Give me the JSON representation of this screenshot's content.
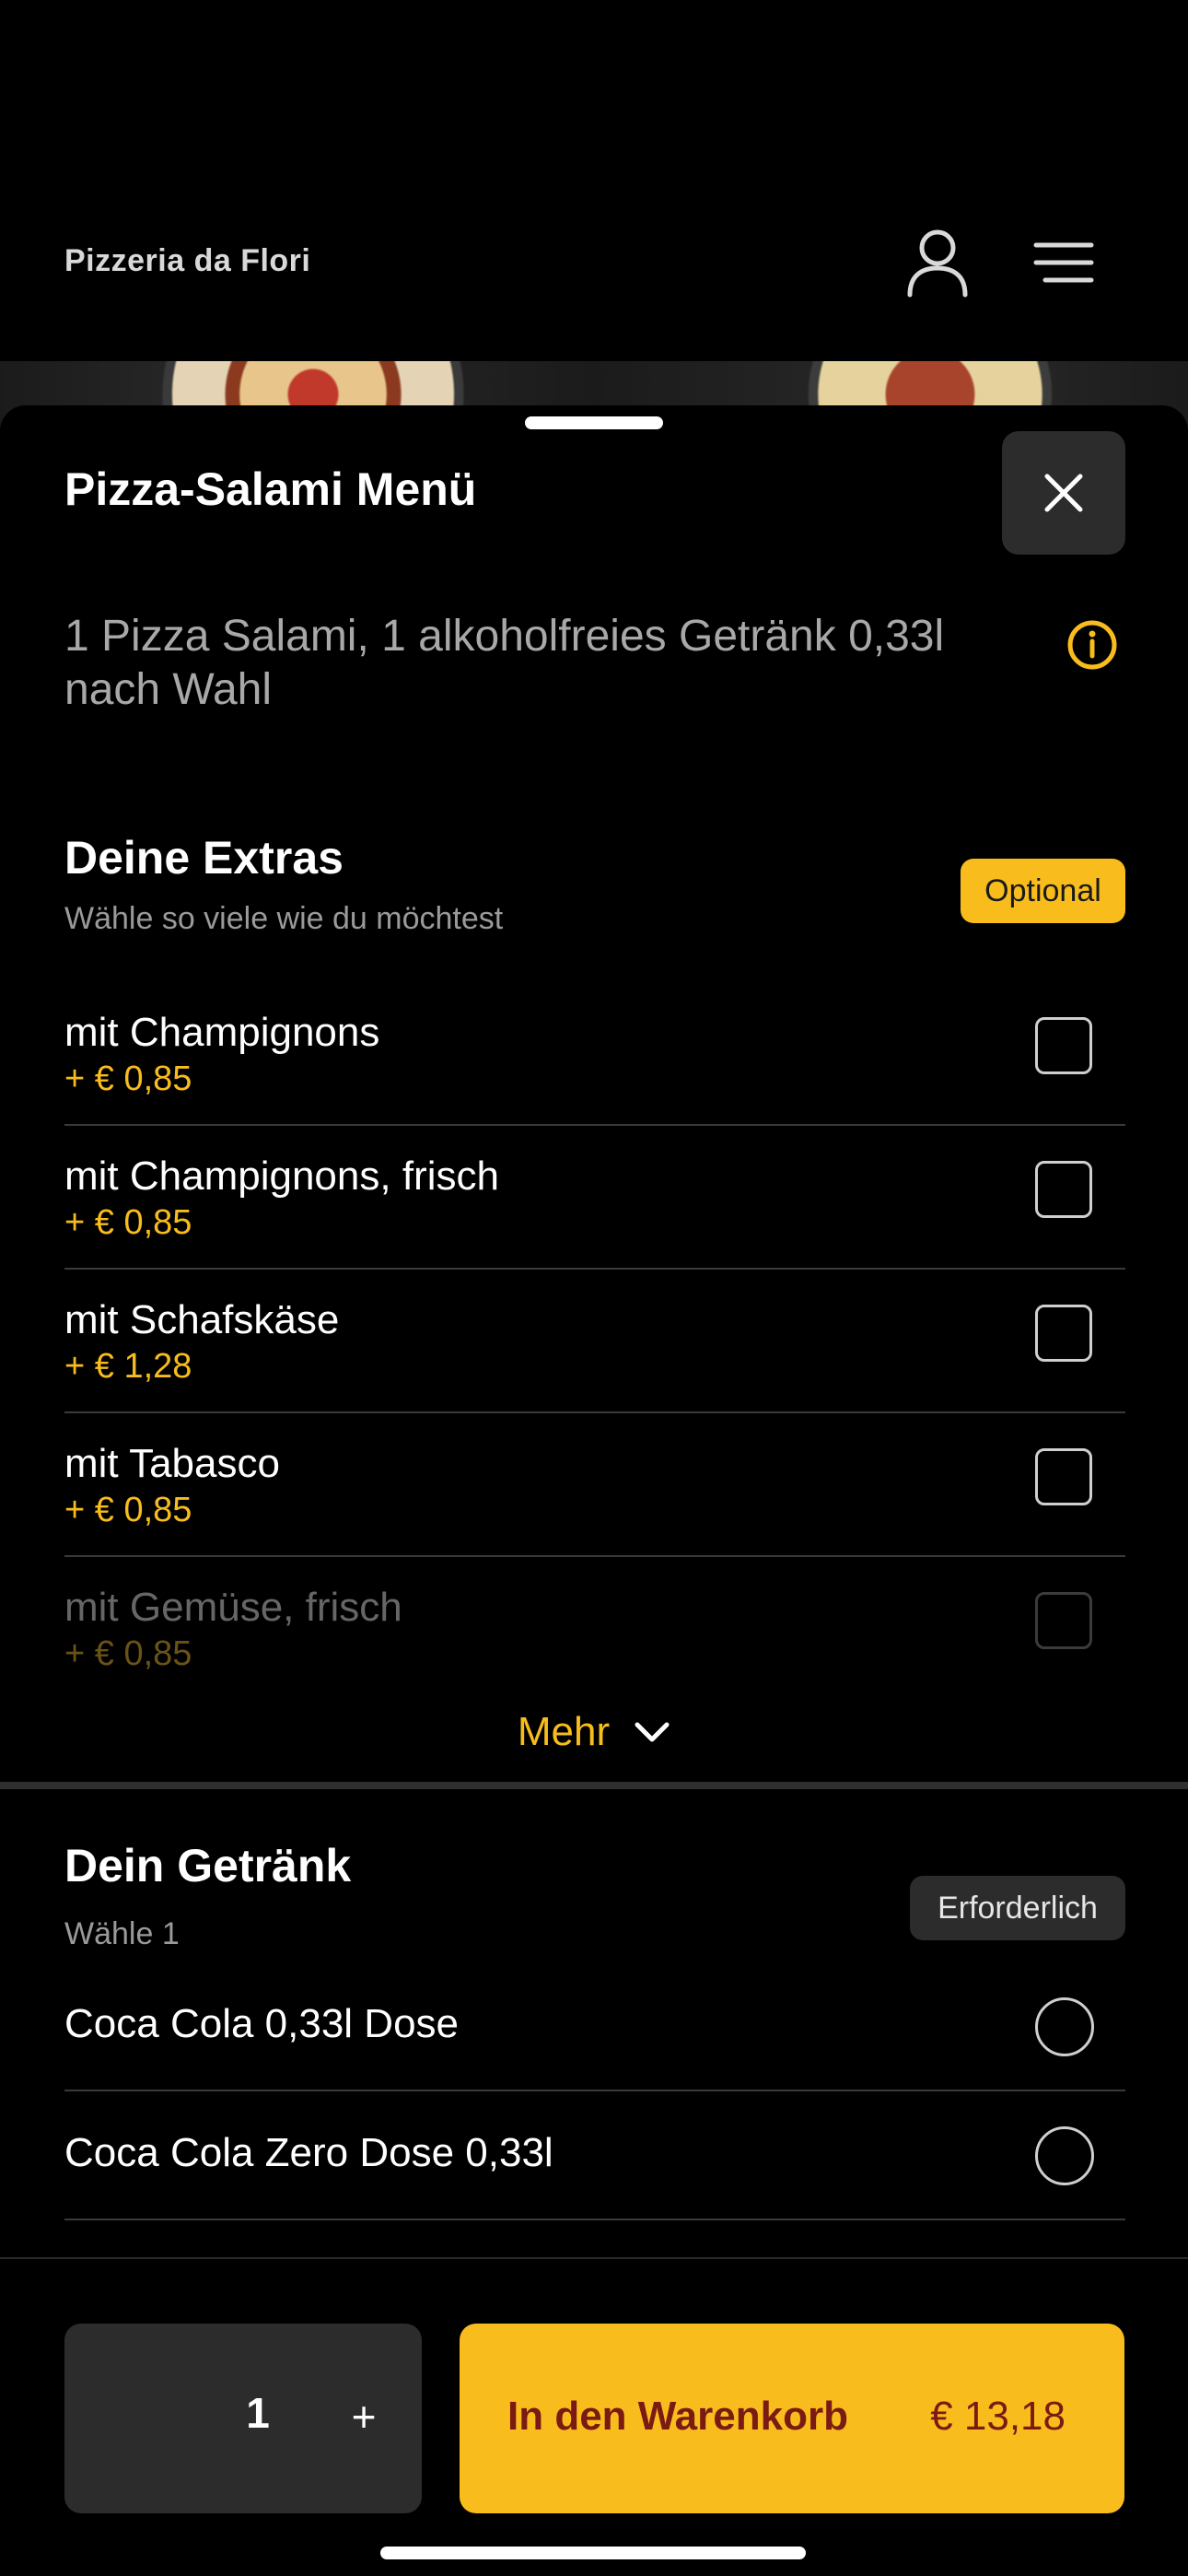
{
  "header": {
    "brand": "Pizzeria da Flori",
    "user_icon": "user-icon",
    "menu_icon": "hamburger-menu-icon"
  },
  "sheet": {
    "title": "Pizza-Salami Menü",
    "close_icon": "close-icon",
    "description": "1 Pizza Salami, 1 alkoholfreies Getränk 0,33l nach Wahl",
    "info_icon": "info-icon"
  },
  "extras": {
    "title": "Deine Extras",
    "subtitle": "Wähle so viele wie du möchtest",
    "badge": "Optional",
    "items": [
      {
        "name": "mit Champignons",
        "price": "+ € 0,85"
      },
      {
        "name": "mit Champignons, frisch",
        "price": "+ € 0,85"
      },
      {
        "name": "mit Schafskäse",
        "price": "+ € 1,28"
      },
      {
        "name": "mit Tabasco",
        "price": "+ € 0,85"
      },
      {
        "name": "mit Gemüse, frisch",
        "price": "+ € 0,85"
      }
    ],
    "more_label": "Mehr"
  },
  "drinks": {
    "title": "Dein Getränk",
    "subtitle": "Wähle 1",
    "badge": "Erforderlich",
    "items": [
      {
        "name": "Coca Cola 0,33l Dose"
      },
      {
        "name": "Coca Cola Zero Dose 0,33l"
      }
    ]
  },
  "footer": {
    "quantity": "1",
    "plus": "+",
    "cart_label": "In den Warenkorb",
    "total": "€ 13,18"
  },
  "colors": {
    "accent": "#f8bd1c",
    "cart_text": "#7a1a12",
    "surface": "#2c2c2c",
    "background": "#000000"
  }
}
